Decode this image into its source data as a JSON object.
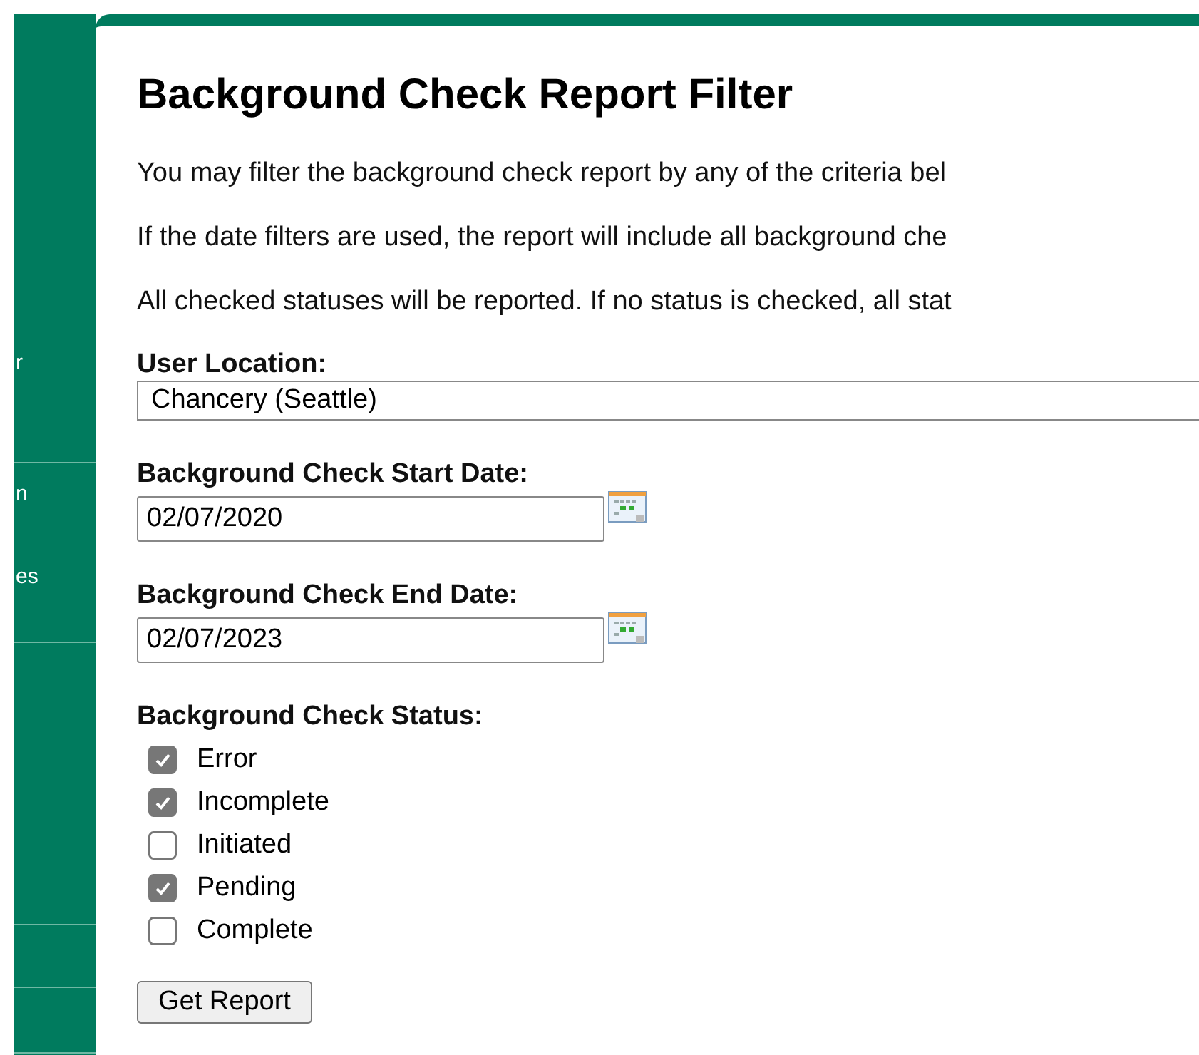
{
  "sidebar": {
    "items": [
      {
        "label": "r"
      },
      {
        "label": "n"
      },
      {
        "label": "es"
      }
    ]
  },
  "title": "Background Check Report Filter",
  "paragraphs": [
    "You may filter the background check report by any of the criteria bel",
    "If the date filters are used, the report will include all background che",
    "All checked statuses will be reported. If no status is checked, all stat"
  ],
  "location": {
    "label": "User Location:",
    "value": "Chancery (Seattle)"
  },
  "dates": [
    {
      "label": "Background Check Start Date:",
      "value": "02/07/2020"
    },
    {
      "label": "Background Check End Date:",
      "value": "02/07/2023"
    }
  ],
  "status": {
    "label": "Background Check Status:",
    "options": [
      {
        "label": "Error",
        "checked": true
      },
      {
        "label": "Incomplete",
        "checked": true
      },
      {
        "label": "Initiated",
        "checked": false
      },
      {
        "label": "Pending",
        "checked": true
      },
      {
        "label": "Complete",
        "checked": false
      }
    ]
  },
  "button": "Get Report"
}
